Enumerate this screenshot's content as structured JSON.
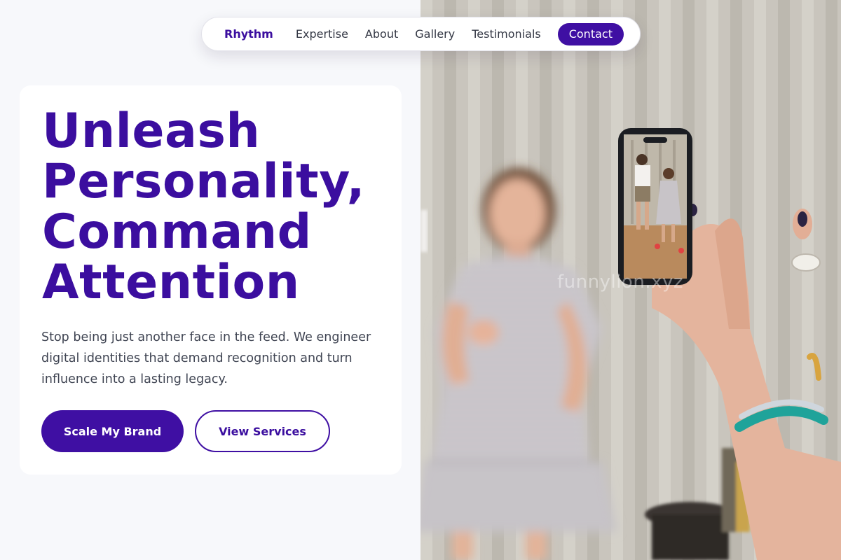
{
  "nav": {
    "brand": "Rhythm",
    "links": [
      "Expertise",
      "About",
      "Gallery",
      "Testimonials"
    ],
    "cta": "Contact"
  },
  "hero": {
    "headline_lines": [
      "Unleash",
      "Personality,",
      "Command",
      "Attention"
    ],
    "subtext": "Stop being just another face in the feed. We engineer digital identities that demand recognition and turn influence into a lasting legacy.",
    "primary_button": "Scale My Brand",
    "secondary_button": "View Services"
  },
  "photo": {
    "description_icon": "phone-recording-photo",
    "watermark": "funnylion.xyz"
  },
  "colors": {
    "brand_purple": "#3b0e9f",
    "button_purple": "#3f0fa3",
    "page_bg": "#f7f8fb",
    "card_bg": "#ffffff"
  }
}
